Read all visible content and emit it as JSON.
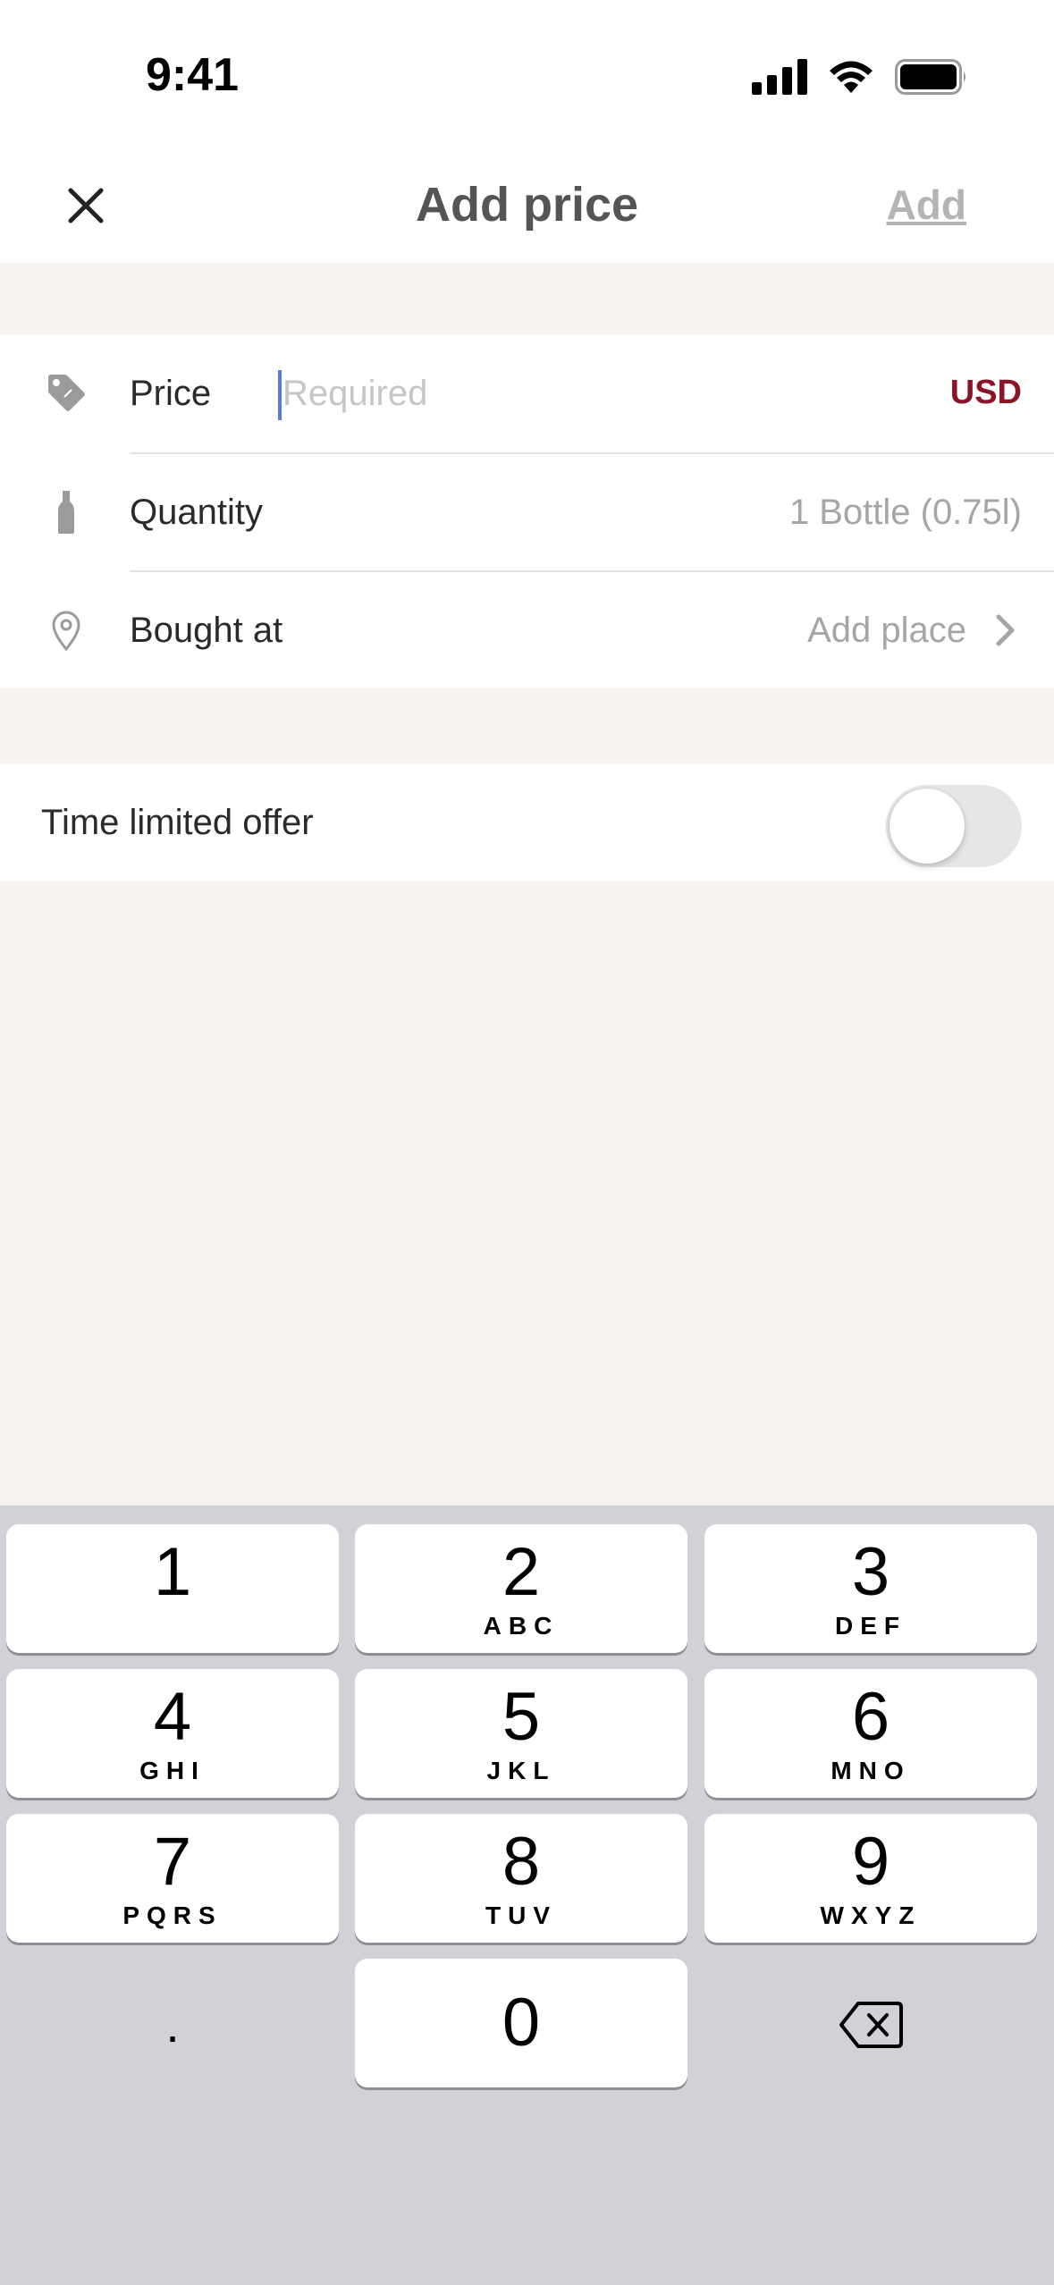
{
  "status_bar": {
    "time": "9:41"
  },
  "nav": {
    "title": "Add price",
    "add_label": "Add"
  },
  "form": {
    "price": {
      "label": "Price",
      "placeholder": "Required",
      "value": "",
      "currency": "USD"
    },
    "quantity": {
      "label": "Quantity",
      "value": "1 Bottle (0.75l)"
    },
    "bought_at": {
      "label": "Bought at",
      "value": "Add place"
    }
  },
  "offer": {
    "label": "Time limited offer",
    "enabled": false
  },
  "keyboard": {
    "keys": [
      {
        "digit": "1",
        "letters": ""
      },
      {
        "digit": "2",
        "letters": "ABC"
      },
      {
        "digit": "3",
        "letters": "DEF"
      },
      {
        "digit": "4",
        "letters": "GHI"
      },
      {
        "digit": "5",
        "letters": "JKL"
      },
      {
        "digit": "6",
        "letters": "MNO"
      },
      {
        "digit": "7",
        "letters": "PQRS"
      },
      {
        "digit": "8",
        "letters": "TUV"
      },
      {
        "digit": "9",
        "letters": "WXYZ"
      }
    ],
    "decimal": ".",
    "zero": "0"
  },
  "colors": {
    "accent": "#8b1527",
    "caret": "#5b78e8",
    "background": "#f5f2ef",
    "keyboard_bg": "#d1d2d7"
  }
}
